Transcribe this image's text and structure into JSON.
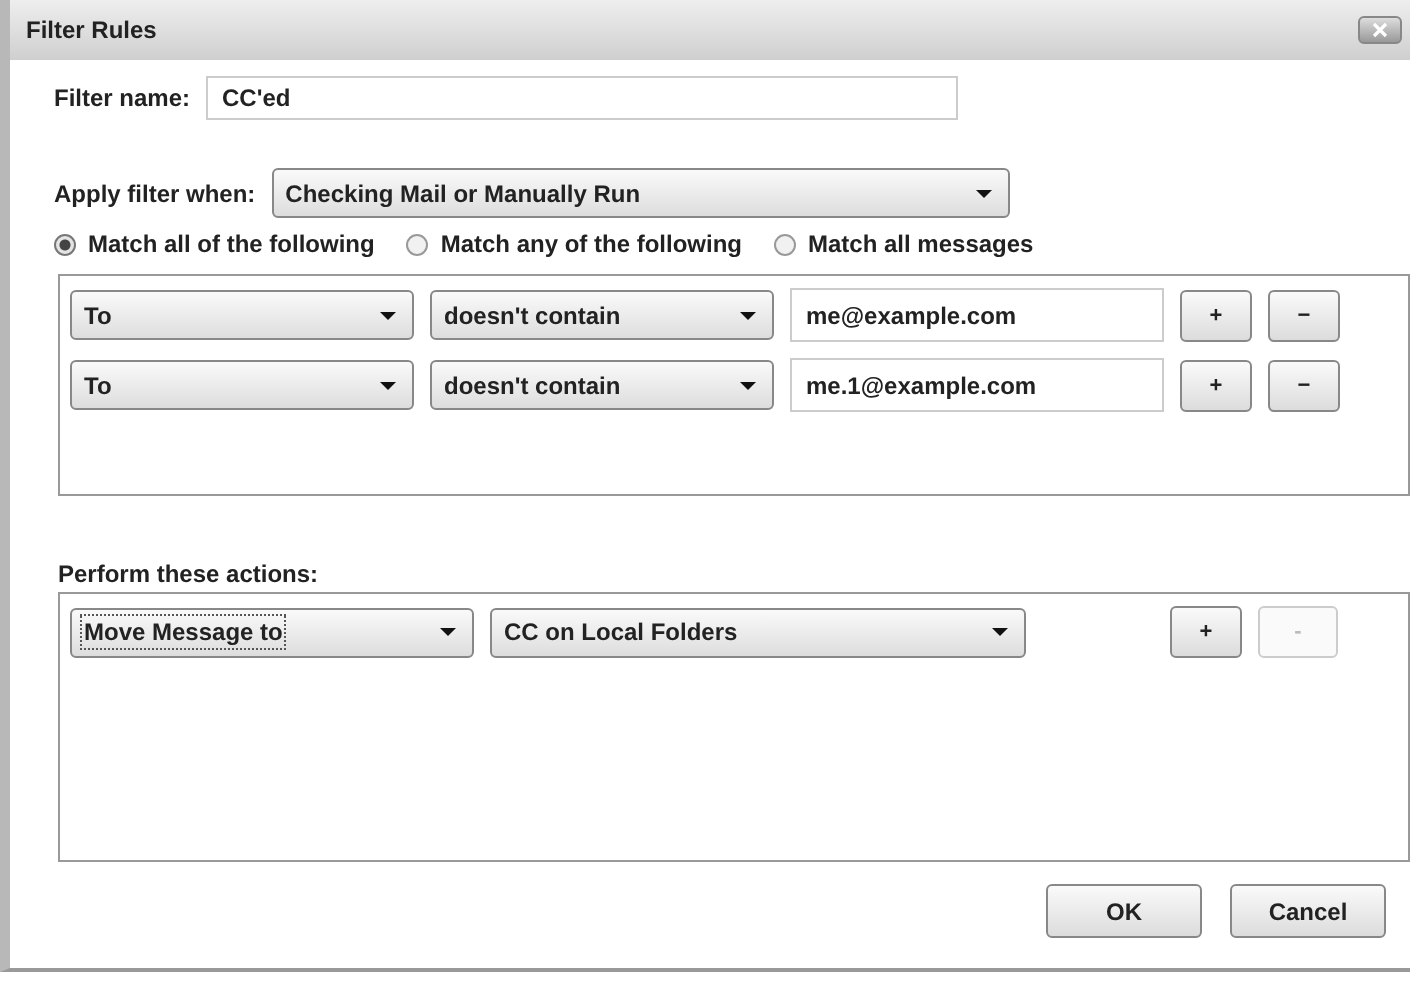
{
  "window": {
    "title": "Filter Rules"
  },
  "filter_name": {
    "label": "Filter name:",
    "value": "CC'ed"
  },
  "apply_when": {
    "label": "Apply filter when:",
    "value": "Checking Mail or Manually Run"
  },
  "match_options": [
    {
      "label": "Match all of the following",
      "selected": true
    },
    {
      "label": "Match any of the following",
      "selected": false
    },
    {
      "label": "Match all messages",
      "selected": false
    }
  ],
  "conditions": [
    {
      "field": "To",
      "operator": "doesn't contain",
      "value": "me@example.com",
      "add": "+",
      "remove": "−"
    },
    {
      "field": "To",
      "operator": "doesn't contain",
      "value": "me.1@example.com",
      "add": "+",
      "remove": "−"
    }
  ],
  "actions_label": "Perform these actions:",
  "actions": [
    {
      "action": "Move Message to",
      "focused": true,
      "target": "CC on Local Folders",
      "add": "+",
      "remove": "-",
      "remove_disabled": true
    }
  ],
  "buttons": [
    "OK",
    "Cancel"
  ]
}
